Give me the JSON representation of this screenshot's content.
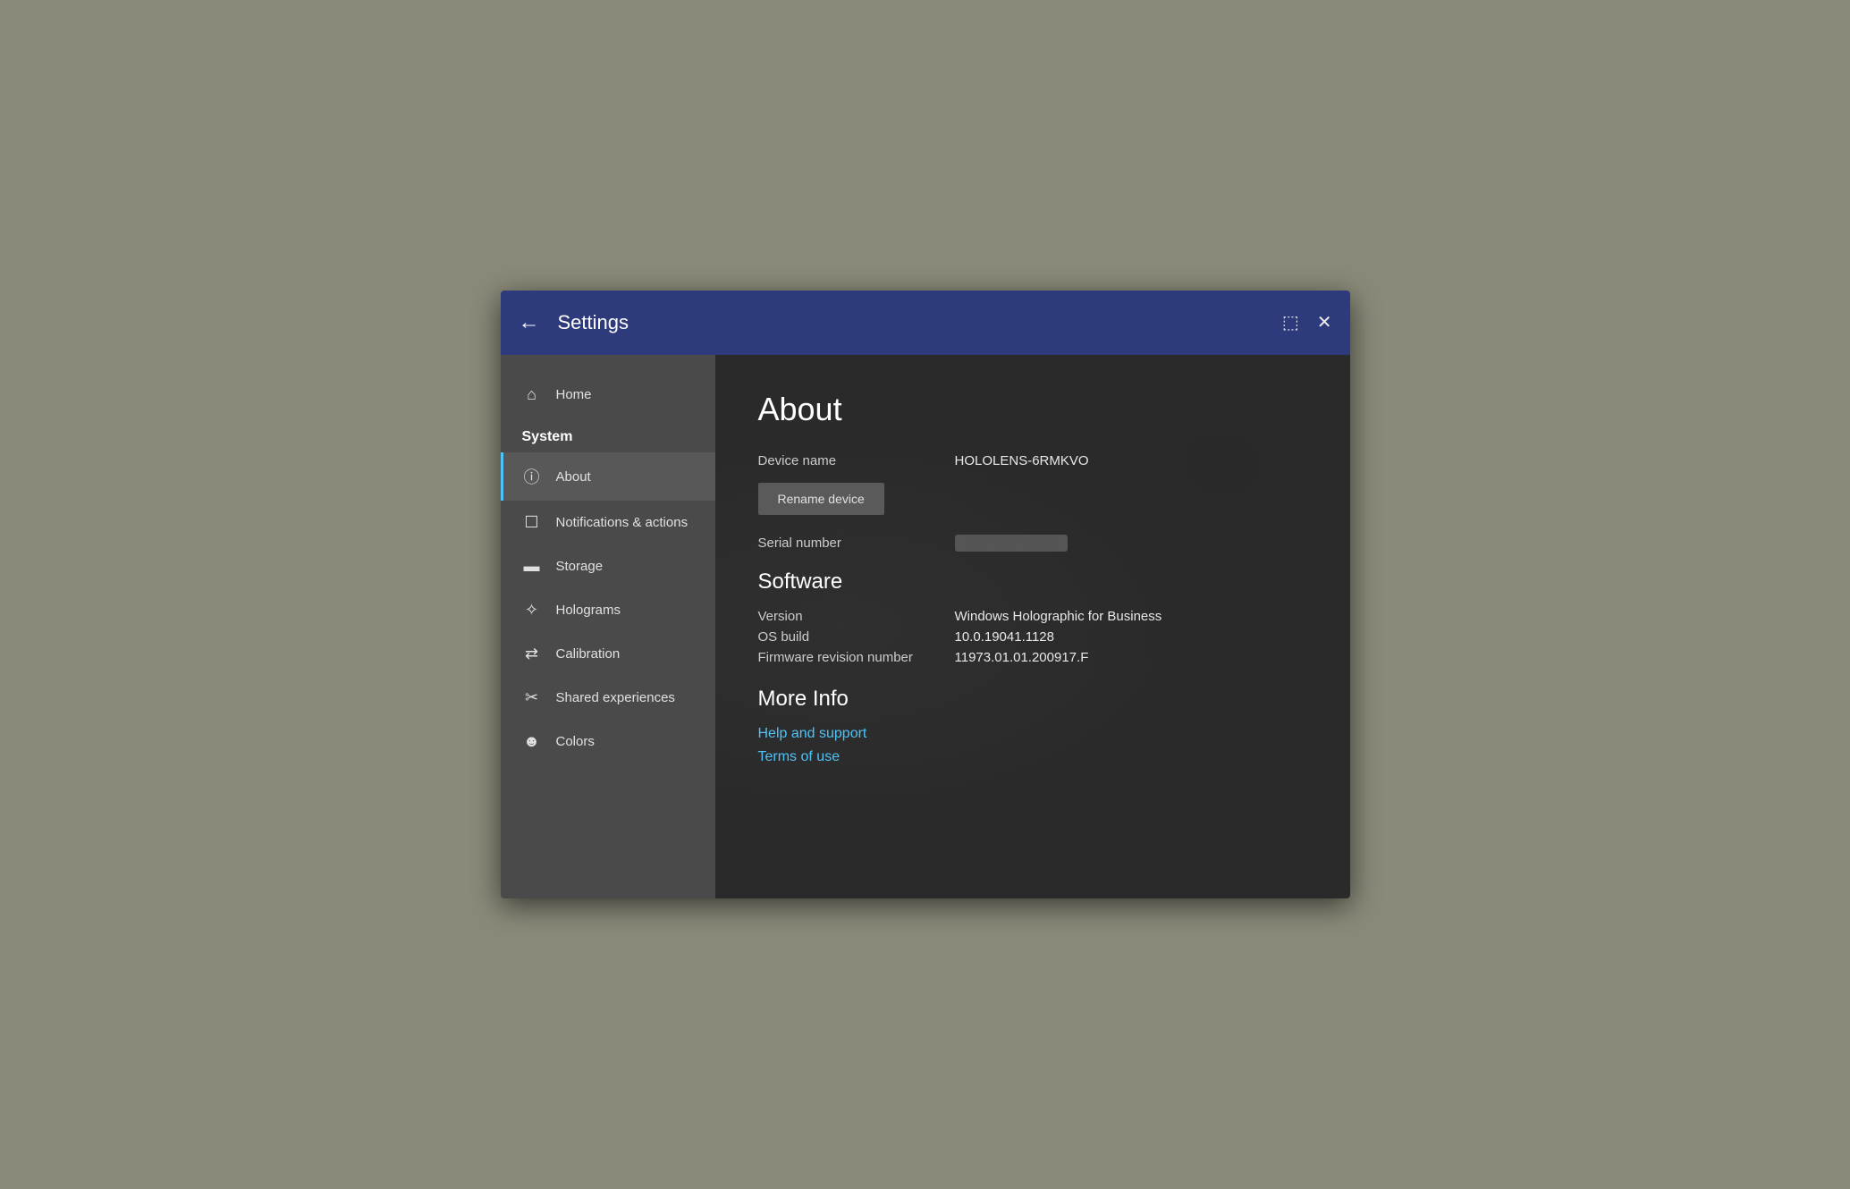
{
  "titlebar": {
    "back_icon": "←",
    "title": "Settings",
    "snap_icon": "⬚",
    "close_icon": "✕"
  },
  "sidebar": {
    "home_label": "Home",
    "system_label": "System",
    "items": [
      {
        "id": "about",
        "label": "About",
        "icon": "ℹ",
        "active": true
      },
      {
        "id": "notifications",
        "label": "Notifications & actions",
        "icon": "🗨",
        "active": false
      },
      {
        "id": "storage",
        "label": "Storage",
        "icon": "▭",
        "active": false
      },
      {
        "id": "holograms",
        "label": "Holograms",
        "icon": "✦",
        "active": false
      },
      {
        "id": "calibration",
        "label": "Calibration",
        "icon": "⇌",
        "active": false
      },
      {
        "id": "shared",
        "label": "Shared experiences",
        "icon": "✂",
        "active": false
      },
      {
        "id": "colors",
        "label": "Colors",
        "icon": "☺",
        "active": false
      }
    ]
  },
  "main": {
    "page_title": "About",
    "device_name_label": "Device name",
    "device_name_value": "HOLOLENS-6RMKVO",
    "rename_button": "Rename device",
    "serial_number_label": "Serial number",
    "serial_number_value": "••••••••••",
    "software_section": "Software",
    "version_label": "Version",
    "version_value": "Windows Holographic for Business",
    "os_build_label": "OS build",
    "os_build_value": "10.0.19041.1128",
    "firmware_label": "Firmware revision number",
    "firmware_value": "11973.01.01.200917.F",
    "more_info_title": "More Info",
    "help_link": "Help and support",
    "terms_link": "Terms of use"
  }
}
